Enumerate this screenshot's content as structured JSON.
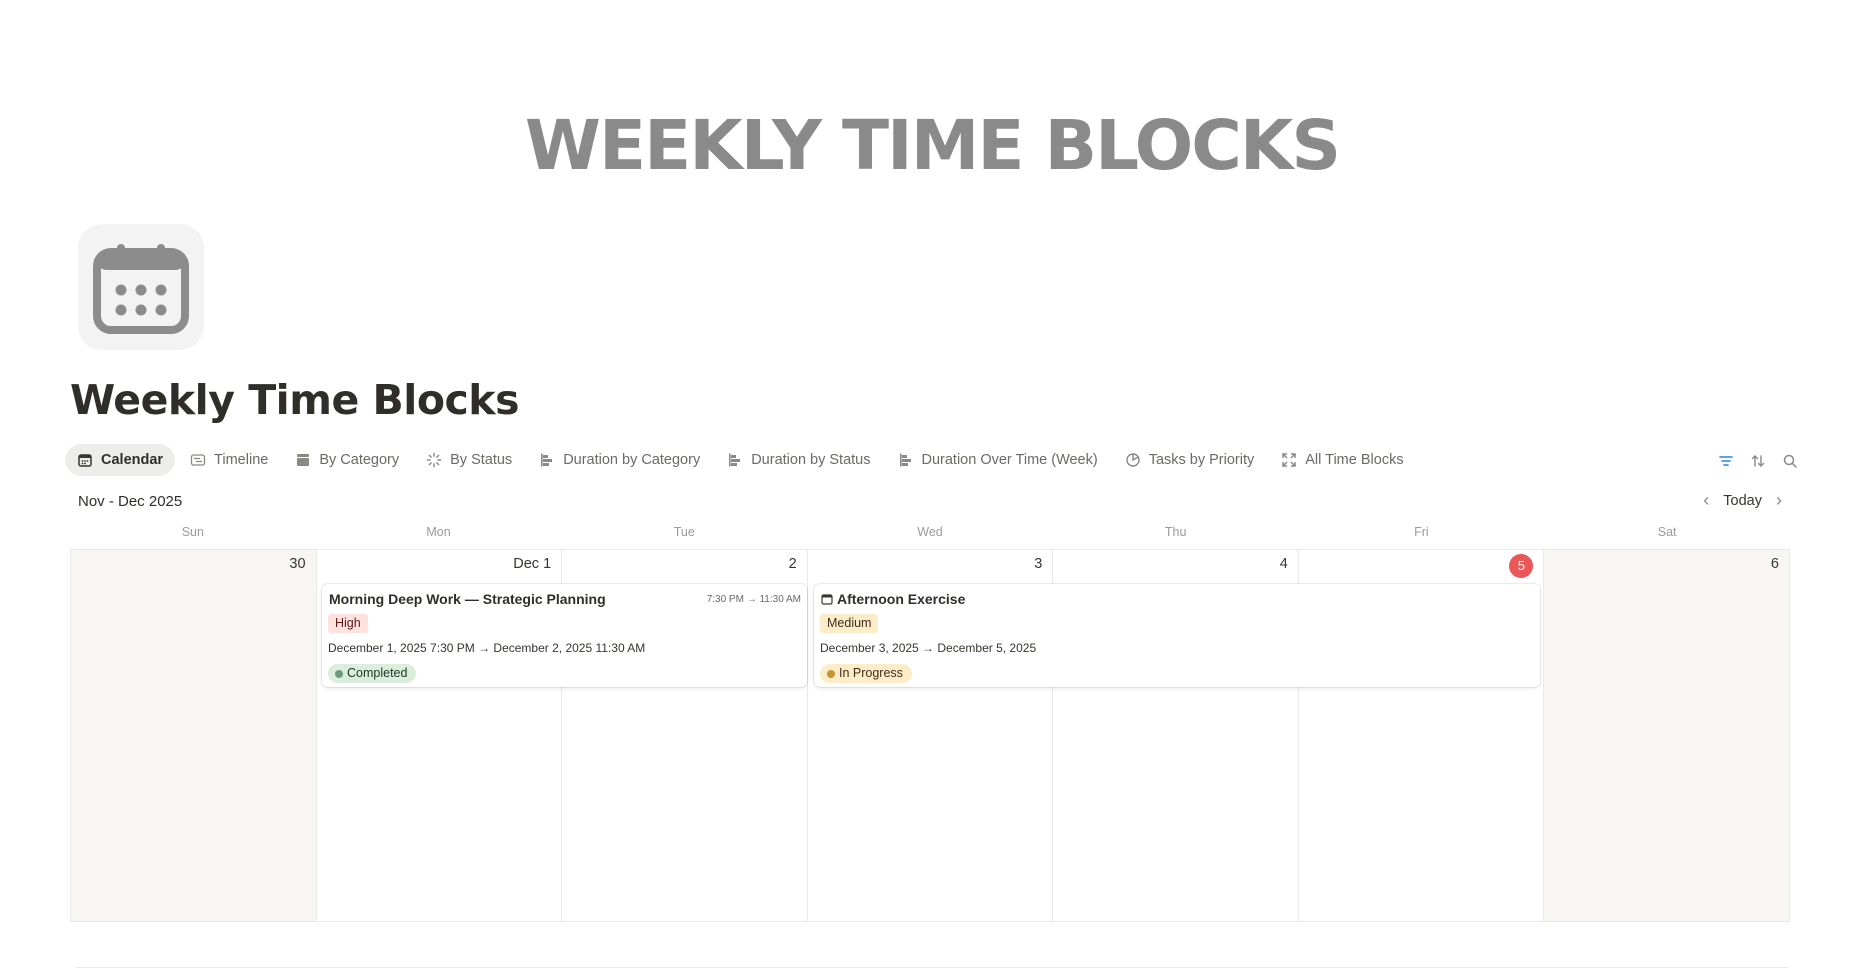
{
  "banner": {
    "text": "WEEKLY TIME BLOCKS"
  },
  "page": {
    "icon": "calendar-icon",
    "title": "Weekly Time Blocks"
  },
  "tabs": [
    {
      "label": "Calendar",
      "icon": "calendar-icon",
      "active": true
    },
    {
      "label": "Timeline",
      "icon": "timeline-icon"
    },
    {
      "label": "By Category",
      "icon": "board-icon"
    },
    {
      "label": "By Status",
      "icon": "loader-icon"
    },
    {
      "label": "Duration by Category",
      "icon": "bar-chart-icon"
    },
    {
      "label": "Duration by Status",
      "icon": "bar-chart-icon"
    },
    {
      "label": "Duration Over Time (Week)",
      "icon": "bar-chart-icon"
    },
    {
      "label": "Tasks by Priority",
      "icon": "pie-chart-icon"
    },
    {
      "label": "All Time Blocks",
      "icon": "expand-icon"
    }
  ],
  "toolbar": {
    "icons": [
      "filter-icon",
      "sort-icon",
      "search-icon"
    ]
  },
  "calendar": {
    "month_label": "Nov - Dec 2025",
    "today_label": "Today",
    "weekdays": [
      "Sun",
      "Mon",
      "Tue",
      "Wed",
      "Thu",
      "Fri",
      "Sat"
    ],
    "days": [
      "30",
      "Dec 1",
      "2",
      "3",
      "4",
      "5",
      "6"
    ],
    "today_index": 5,
    "accent": "#eb5757",
    "events": [
      {
        "title": "Morning Deep Work — Strategic Planning",
        "time": "7:30 PM → 11:30 AM",
        "tag": "High",
        "dates": "December 1, 2025 7:30 PM → December 2, 2025 11:30 AM",
        "status": "Completed"
      },
      {
        "title": "Afternoon Exercise",
        "title_icon": "calendar-icon",
        "tag": "Medium",
        "dates": "December 3, 2025 → December 5, 2025",
        "status": "In Progress"
      }
    ]
  },
  "colors": {
    "tag_high_bg": "#ffe2dd",
    "tag_high_fg": "#5d1715",
    "tag_medium_bg": "#fdecc8",
    "tag_medium_fg": "#402c1b",
    "status_completed_bg": "#dbeddb",
    "status_completed_dot": "#6c9b7d",
    "status_inprogress_bg": "#fdecc8",
    "status_inprogress_dot": "#cb9433"
  }
}
